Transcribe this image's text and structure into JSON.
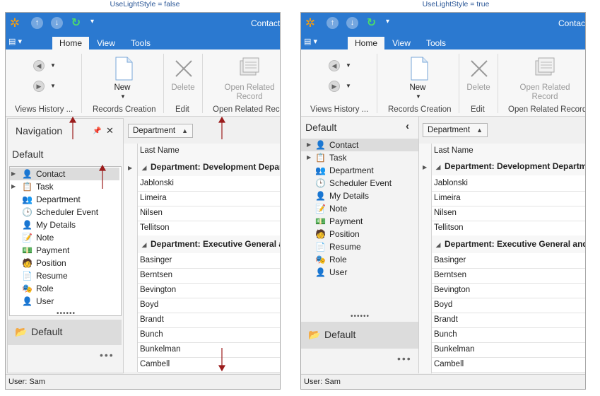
{
  "captions": {
    "left": "UseLightStyle = false",
    "right": "UseLightStyle = true"
  },
  "window": {
    "title": "Contact",
    "tabs": [
      "Home",
      "View",
      "Tools"
    ]
  },
  "ribbon": {
    "groups": {
      "views_history": "Views History ...",
      "records_creation": "Records Creation",
      "edit": "Edit",
      "open_related": "Open Related Record"
    },
    "buttons": {
      "new": "New",
      "delete": "Delete",
      "open_related_line1": "Open Related",
      "open_related_line2": "Record"
    }
  },
  "left_nav": {
    "header": "Navigation",
    "group": "Default"
  },
  "right_nav": {
    "header": "Default"
  },
  "nav_items": [
    "Contact",
    "Task",
    "Department",
    "Scheduler Event",
    "My Details",
    "Note",
    "Payment",
    "Position",
    "Resume",
    "Role",
    "User"
  ],
  "nav_group_bottom": "Default",
  "grid": {
    "group_by": "Department",
    "column": "Last Name",
    "group_rows": [
      "Department: Development Department",
      "Department: Executive General and Administration"
    ],
    "group1_rows": [
      "Jablonski",
      "Limeira",
      "Nilsen",
      "Tellitson"
    ],
    "group2_rows": [
      "Basinger",
      "Berntsen",
      "Bevington",
      "Boyd",
      "Brandt",
      "Bunch",
      "Bunkelman",
      "Cambell"
    ]
  },
  "status": "User: Sam",
  "colors": {
    "accent": "#2b79d0",
    "arrow": "#9b1c1c"
  }
}
